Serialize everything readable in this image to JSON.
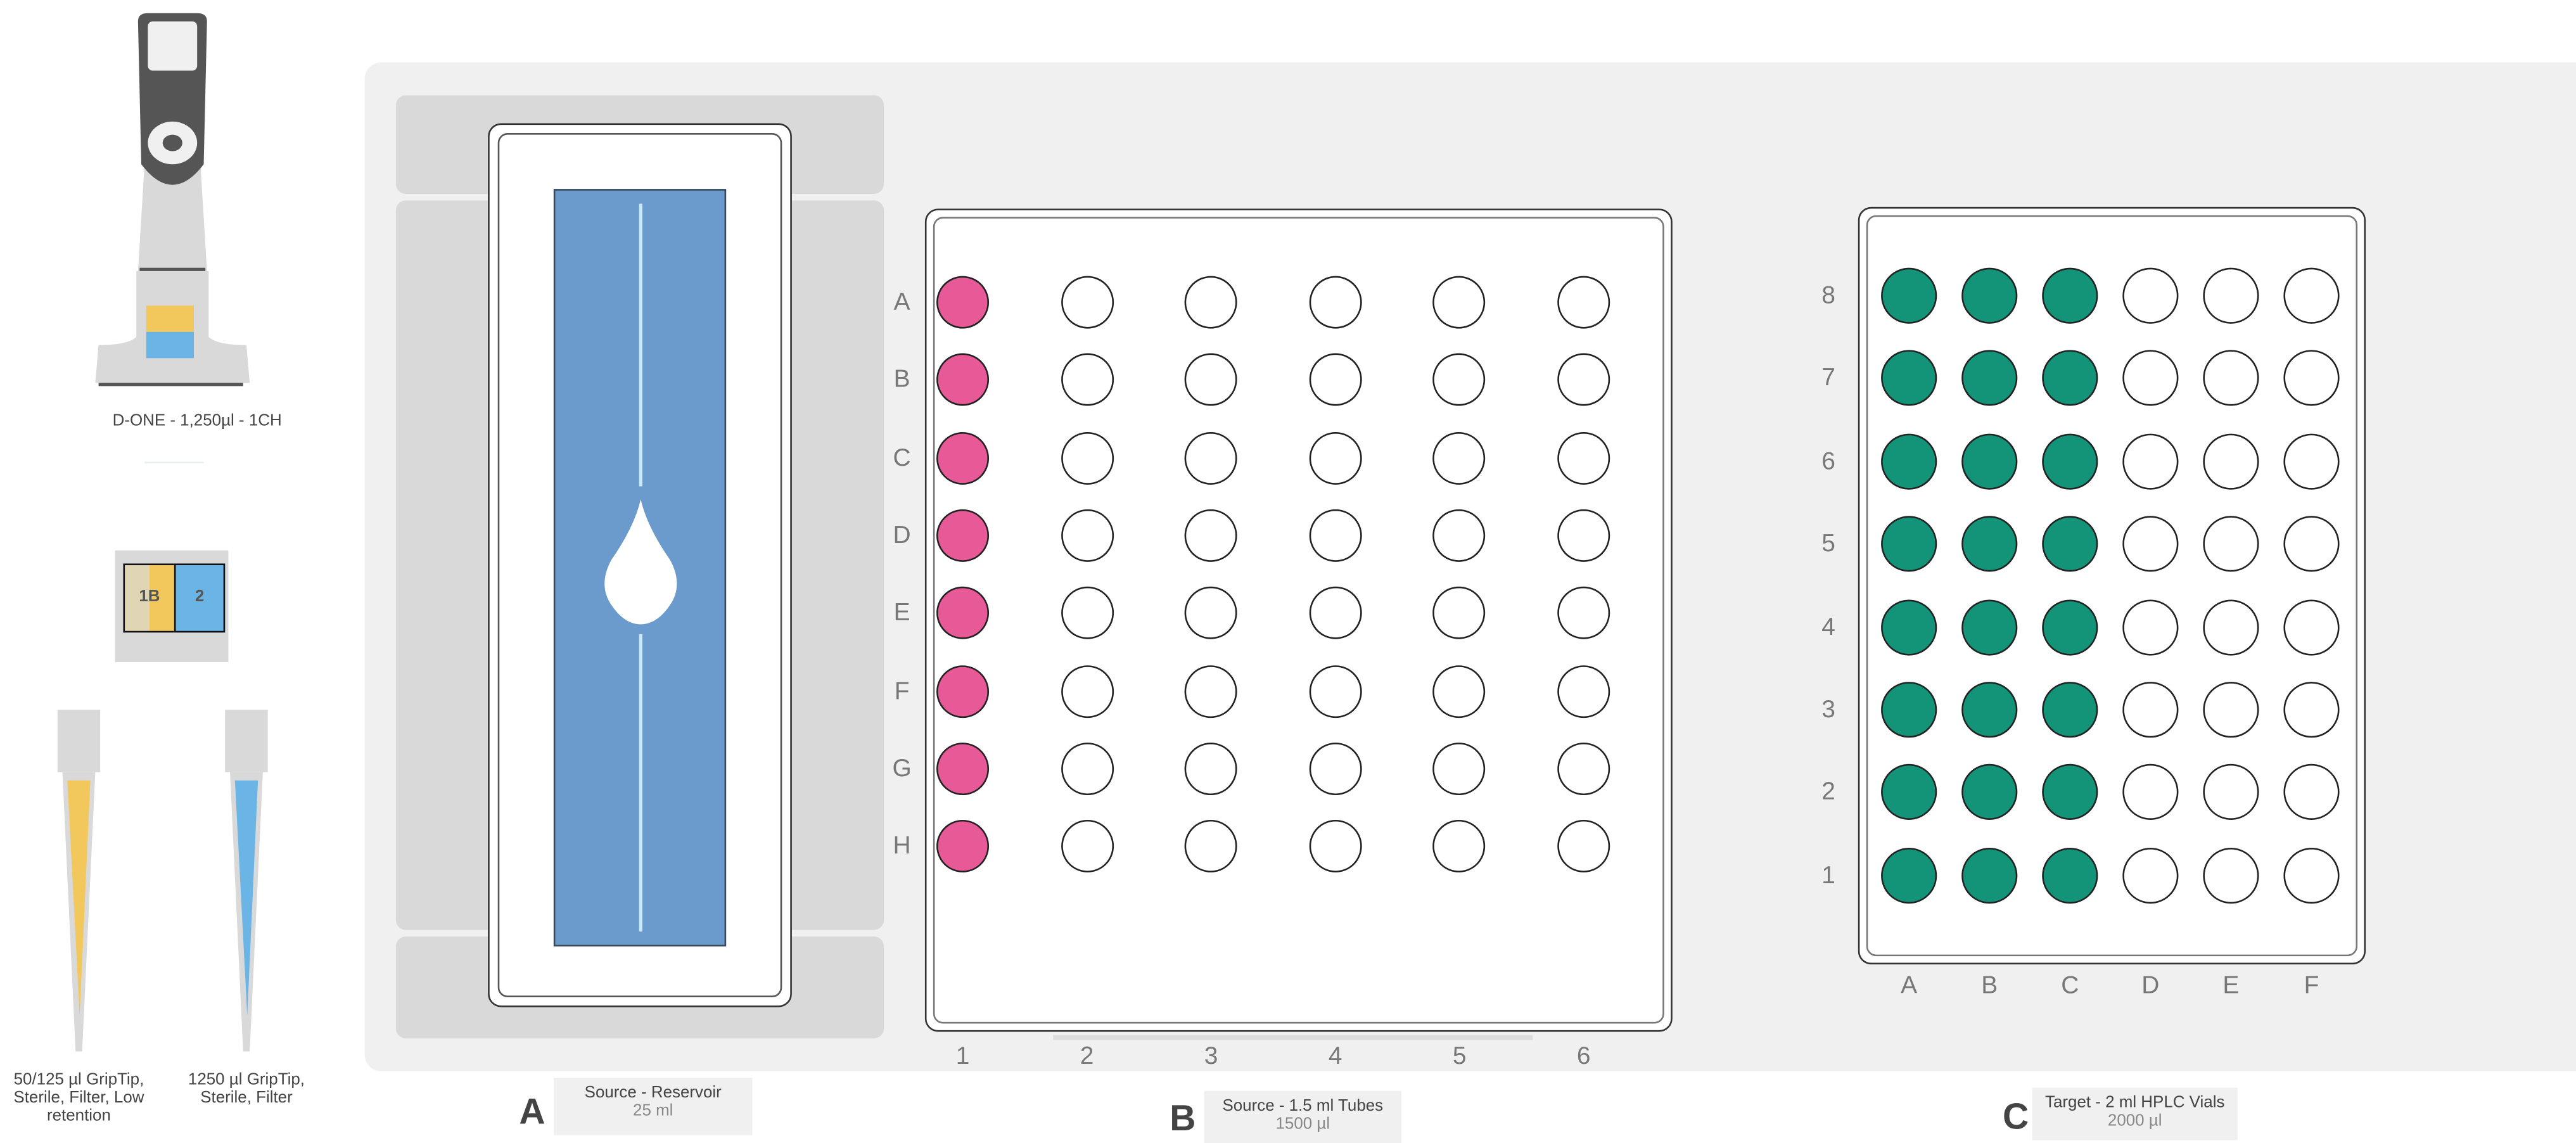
{
  "pipette": {
    "label": "D-ONE - 1,250µl - 1CH",
    "colors": {
      "body": "#555555",
      "slot1": "#f2c75c",
      "slot2": "#6ab4e6"
    }
  },
  "tip_rack": {
    "slot1": "1B",
    "slot2": "2"
  },
  "tips": [
    {
      "label": "50/125 µl GripTip, Sterile, Filter, Low retention",
      "color": "#f2c75c"
    },
    {
      "label": "1250 µl GripTip, Sterile, Filter",
      "color": "#6ab4e6"
    }
  ],
  "positions": [
    {
      "letter": "A",
      "title": "Source - Reservoir",
      "volume": "25 ml"
    },
    {
      "letter": "B",
      "title": "Source - 1.5 ml Tubes",
      "volume": "1500 µl"
    },
    {
      "letter": "C",
      "title": "Target - 2 ml HPLC Vials",
      "volume": "2000 µl"
    }
  ],
  "reservoir": {
    "color": "#6b9bcc",
    "icon": "droplet-icon"
  },
  "plate_b": {
    "rows": [
      "A",
      "B",
      "C",
      "D",
      "E",
      "F",
      "G",
      "H"
    ],
    "cols": [
      "1",
      "2",
      "3",
      "4",
      "5",
      "6"
    ],
    "filled_cols": [
      "1"
    ],
    "fill_color": "#e85a97"
  },
  "plate_c": {
    "rows": [
      "8",
      "7",
      "6",
      "5",
      "4",
      "3",
      "2",
      "1"
    ],
    "cols": [
      "A",
      "B",
      "C",
      "D",
      "E",
      "F"
    ],
    "filled_cols": [
      "A",
      "B",
      "C"
    ],
    "fill_color": "#139479"
  }
}
